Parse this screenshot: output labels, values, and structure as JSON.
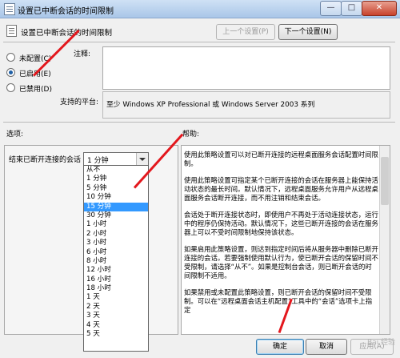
{
  "window": {
    "title": "设置已中断会话的时间限制",
    "controls": [
      "—",
      "□",
      "✕"
    ]
  },
  "header": {
    "policy_title": "设置已中断会话的时间限制",
    "prev_button": "上一个设置(P)",
    "next_button": "下一个设置(N)"
  },
  "state": {
    "options": [
      "未配置(C)",
      "已启用(E)",
      "已禁用(D)"
    ],
    "selected_index": 1
  },
  "comment": {
    "label": "注释:",
    "value": ""
  },
  "platform": {
    "label": "支持的平台:",
    "value": "至少 Windows XP Professional 或 Windows Server 2003 系列"
  },
  "options_section": {
    "label": "选项:",
    "field_label": "结束已断开连接的会话",
    "selected_value": "1 分钟",
    "dropdown_items": [
      "从不",
      "1 分钟",
      "5 分钟",
      "10 分钟",
      "15 分钟",
      "30 分钟",
      "1 小时",
      "2 小时",
      "3 小时",
      "6 小时",
      "8 小时",
      "12 小时",
      "16 小时",
      "18 小时",
      "1 天",
      "2 天",
      "3 天",
      "4 天",
      "5 天"
    ],
    "highlighted_index": 4
  },
  "help": {
    "label": "帮助:",
    "paragraphs": [
      "使用此策略设置可以对已断开连接的远程桌面服务会话配置时间限制。",
      "使用此策略设置可指定某个已断开连接的会话在服务器上能保持活动状态的最长时间。默认情况下，远程桌面服务允许用户从远程桌面服务会话断开连接，而不用注销和结束会话。",
      "会话处于断开连接状态时，即使用户不再处于活动连接状态，运行中的程序仍保持活动。默认情况下，这些已断开连接的会话在服务器上可以不受时间限制地保持该状态。",
      "如果启用此策略设置，则达到指定时间后将从服务器中删除已断开连接的会话。若要强制使用默认行为，使已断开会话的保留时间不受限制，请选择“从不”。如果是控制台会话，则已断开会话的时间限制不适用。",
      "如果禁用或未配置此策略设置，则已断开会话的保留时间不受限制。可以在“远程桌面会话主机配置”工具中的“会话”选项卡上指定"
    ]
  },
  "footer": {
    "ok": "确定",
    "cancel": "取消",
    "apply": "应用(A)"
  },
  "watermark": "Bai 经验",
  "accent_color": "#3399ff",
  "annotation_color": "#e3171d"
}
